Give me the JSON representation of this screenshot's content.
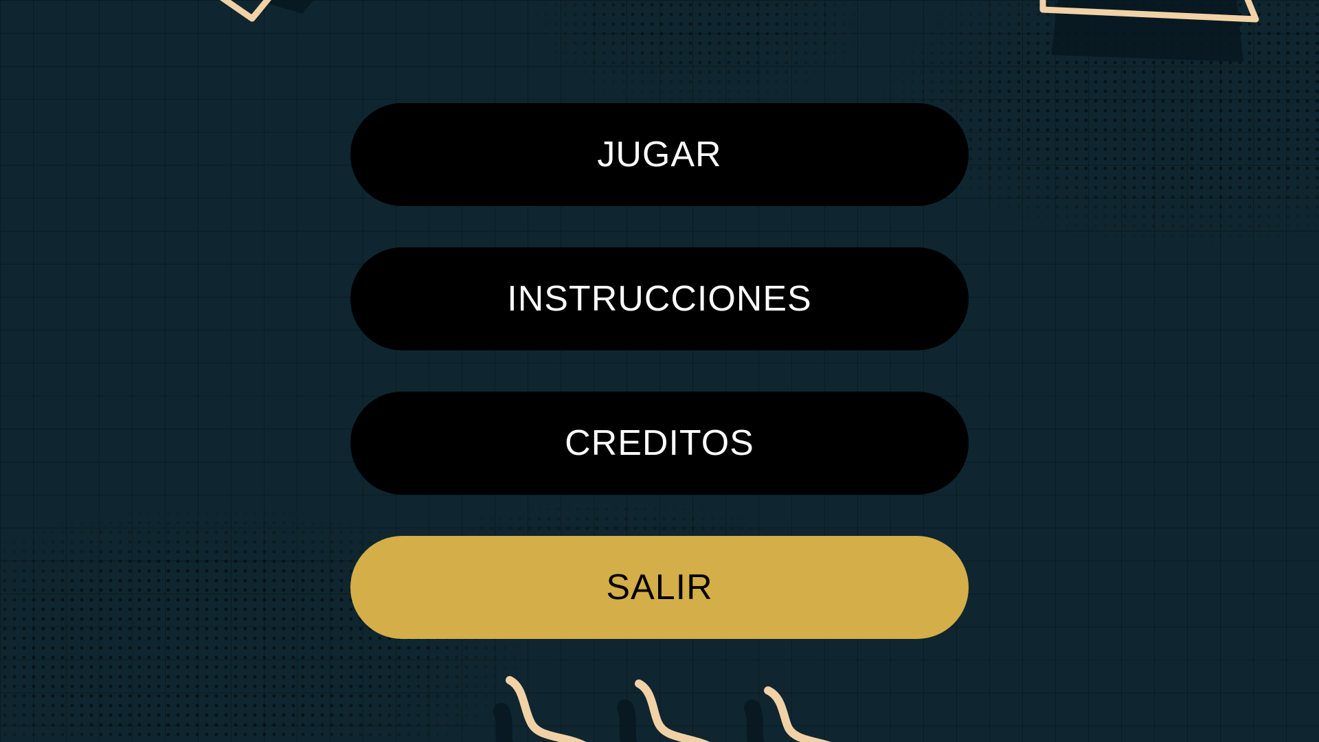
{
  "menu": {
    "play_label": "JUGAR",
    "instructions_label": "INSTRUCCIONES",
    "credits_label": "CREDITOS",
    "exit_label": "SALIR"
  },
  "colors": {
    "background": "#0f2630",
    "button_dark": "#000000",
    "button_accent": "#d4ae48",
    "button_dark_text": "#ffffff",
    "button_accent_text": "#000000",
    "shape_cream": "#f1d2a6"
  },
  "decorations": [
    "diamond-outline-shape",
    "triangle-outline-shape",
    "squiggle-shape"
  ]
}
